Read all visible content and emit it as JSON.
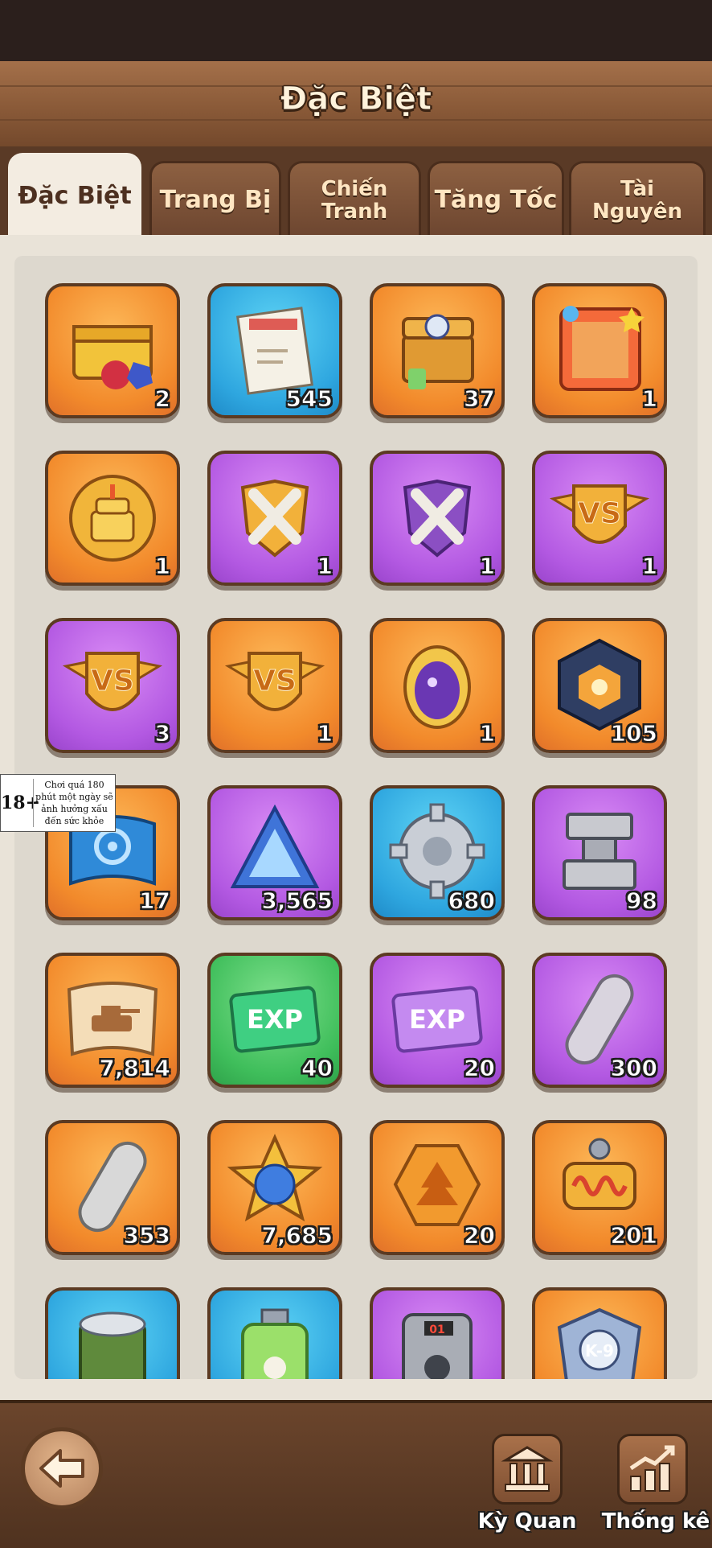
{
  "header": {
    "title": "Đặc Biệt"
  },
  "tabs": [
    {
      "label": "Đặc Biệt",
      "active": true
    },
    {
      "label": "Trang Bị",
      "active": false
    },
    {
      "label": "Chiến Tranh",
      "active": false
    },
    {
      "label": "Tăng Tốc",
      "active": false
    },
    {
      "label": "Tài Nguyên",
      "active": false
    }
  ],
  "age_notice": {
    "rating": "18+",
    "text": "Chơi quá 180 phút một ngày sẽ ảnh hưởng xấu đến sức khỏe"
  },
  "items": [
    {
      "icon": "treasure-chest-gems-icon",
      "count": "2",
      "bg": "orange"
    },
    {
      "icon": "confidential-document-icon",
      "count": "545",
      "bg": "blue"
    },
    {
      "icon": "pet-supply-chest-icon",
      "count": "37",
      "bg": "orange"
    },
    {
      "icon": "birthday-frame-icon",
      "count": "1",
      "bg": "orange"
    },
    {
      "icon": "birthday-cake-badge-icon",
      "count": "1",
      "bg": "orange"
    },
    {
      "icon": "crossed-swords-gold-icon",
      "count": "1",
      "bg": "purple"
    },
    {
      "icon": "crossed-swords-purple-icon",
      "count": "1",
      "bg": "purple"
    },
    {
      "icon": "vs-badge-icon",
      "count": "1",
      "bg": "purple"
    },
    {
      "icon": "vs-badge-icon",
      "count": "3",
      "bg": "purple"
    },
    {
      "icon": "vs-badge-icon",
      "count": "1",
      "bg": "orange"
    },
    {
      "icon": "magic-mirror-icon",
      "count": "1",
      "bg": "orange"
    },
    {
      "icon": "crystal-cube-icon",
      "count": "105",
      "bg": "orange"
    },
    {
      "icon": "blueprint-scroll-icon",
      "count": "17",
      "bg": "orange"
    },
    {
      "icon": "blue-crystal-icon",
      "count": "3,565",
      "bg": "purple"
    },
    {
      "icon": "gear-icon",
      "count": "680",
      "bg": "blue"
    },
    {
      "icon": "steel-anvil-icon",
      "count": "98",
      "bg": "purple"
    },
    {
      "icon": "tank-scroll-icon",
      "count": "7,814",
      "bg": "orange"
    },
    {
      "icon": "exp-ticket-green-icon",
      "count": "40",
      "bg": "green",
      "label": "EXP"
    },
    {
      "icon": "exp-ticket-purple-icon",
      "count": "20",
      "bg": "purple",
      "label": "EXP"
    },
    {
      "icon": "metal-bar-purple-icon",
      "count": "300",
      "bg": "purple"
    },
    {
      "icon": "metal-bar-icon",
      "count": "353",
      "bg": "orange"
    },
    {
      "icon": "star-medal-icon",
      "count": "7,685",
      "bg": "orange"
    },
    {
      "icon": "tree-coin-icon",
      "count": "20",
      "bg": "orange"
    },
    {
      "icon": "spring-coil-icon",
      "count": "201",
      "bg": "orange"
    },
    {
      "icon": "food-can-icon",
      "count": "",
      "bg": "blue"
    },
    {
      "icon": "paw-potion-icon",
      "count": "",
      "bg": "blue"
    },
    {
      "icon": "paw-timer-icon",
      "count": "",
      "bg": "purple",
      "label": "01"
    },
    {
      "icon": "k9-badge-icon",
      "count": "",
      "bg": "orange",
      "label": "K-9"
    }
  ],
  "footer": {
    "wonders_label": "Kỳ Quan",
    "stats_label": "Thống kê"
  }
}
